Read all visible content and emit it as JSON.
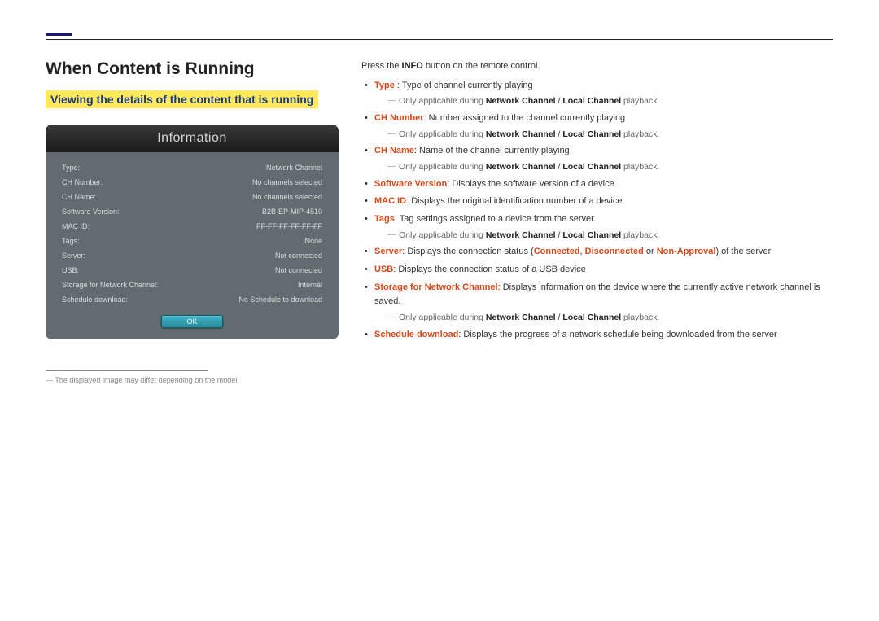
{
  "heading": "When Content is Running",
  "subheading": "Viewing the details of the content that is running",
  "panel": {
    "title": "Information",
    "rows": [
      {
        "label": "Type:",
        "value": "Network Channel"
      },
      {
        "label": "CH Number:",
        "value": "No channels selected"
      },
      {
        "label": "CH Name:",
        "value": "No channels selected"
      },
      {
        "label": "Software Version:",
        "value": "B2B-EP-MIP-4510"
      },
      {
        "label": "MAC ID:",
        "value": "FF-FF-FF-FF-FF-FF"
      },
      {
        "label": "Tags:",
        "value": "None"
      },
      {
        "label": "Server:",
        "value": "Not connected"
      },
      {
        "label": "USB:",
        "value": "Not connected"
      },
      {
        "label": "Storage for Network Channel:",
        "value": "Internal"
      },
      {
        "label": "Schedule download:",
        "value": "No Schedule to download"
      }
    ],
    "ok": "OK"
  },
  "footnote": {
    "dash": "―",
    "text": "The displayed image may differ depending on the model."
  },
  "intro": {
    "prefix": "Press the ",
    "bold": "INFO",
    "suffix": " button on the remote control."
  },
  "items": {
    "type": {
      "term": "Type",
      "sep": " : ",
      "desc": "Type of channel currently playing"
    },
    "chnum": {
      "term": "CH Number",
      "desc": ": Number assigned to the channel currently playing"
    },
    "chname": {
      "term": "CH Name",
      "desc": ": Name of the channel currently playing"
    },
    "sw": {
      "term": "Software Version",
      "desc": ": Displays the software version of a device"
    },
    "mac": {
      "term": "MAC ID",
      "desc": ": Displays the original identification number of a device"
    },
    "tags": {
      "term": "Tags",
      "desc": ": Tag settings assigned to a device from the server"
    },
    "server": {
      "term": "Server",
      "p1": ": Displays the connection status (",
      "c1": "Connected",
      "c2": "Disconnected",
      "c3": "Non-Approval",
      "comma": ", ",
      "or": " or ",
      "p2": ") of the server"
    },
    "usb": {
      "term": "USB",
      "desc": ": Displays the connection status of a USB device"
    },
    "storage": {
      "term": "Storage for Network Channel",
      "desc": ": Displays information on the device where the currently active network channel is saved."
    },
    "schedule": {
      "term": "Schedule download",
      "desc": ": Displays the progress of a network schedule being downloaded from the server"
    }
  },
  "applicable": {
    "prefix": "Only applicable during ",
    "nc": "Network Channel",
    "slash": " / ",
    "lc": "Local Channel",
    "suffix": " playback."
  }
}
